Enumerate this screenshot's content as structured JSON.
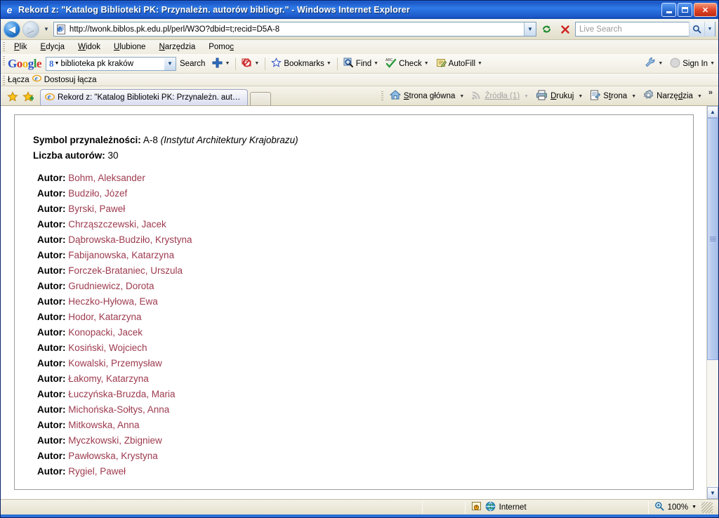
{
  "window": {
    "title": "Rekord z: \"Katalog Biblioteki PK: Przynależn. autorów bibliogr.\" - Windows Internet Explorer",
    "app_icon": "ie-logo-icon",
    "minimize_label": "_",
    "maximize_label": "□",
    "close_label": "✕"
  },
  "nav": {
    "back_label": "◀",
    "forward_label": "▶",
    "history_caret": "▼",
    "address": {
      "url": "http://twonk.biblos.pk.edu.pl/perl/W3O?dbid=t;recid=D5A-8",
      "page_icon": "page-icon",
      "dropdown_label": "▼"
    },
    "refresh_label": "⟳",
    "stop_label": "✕",
    "search": {
      "placeholder": "Live Search",
      "value": "",
      "go_label": "⌕",
      "dropdown_label": "▼"
    }
  },
  "menu": {
    "items": [
      {
        "pre": "P",
        "accel": "l",
        "post": "ik"
      },
      {
        "pre": "",
        "accel": "E",
        "post": "dycja"
      },
      {
        "pre": "",
        "accel": "W",
        "post": "idok"
      },
      {
        "pre": "",
        "accel": "U",
        "post": "lubione"
      },
      {
        "pre": "",
        "accel": "N",
        "post": "arzędzia"
      },
      {
        "pre": "Pomo",
        "accel": "c",
        "post": ""
      }
    ]
  },
  "google_toolbar": {
    "logo": [
      {
        "ch": "G",
        "cls": "b"
      },
      {
        "ch": "o",
        "cls": "r"
      },
      {
        "ch": "o",
        "cls": "y"
      },
      {
        "ch": "g",
        "cls": "b"
      },
      {
        "ch": "l",
        "cls": "g"
      },
      {
        "ch": "e",
        "cls": "r"
      }
    ],
    "search_value": "biblioteka pk kraków",
    "search_g": "8",
    "items": [
      {
        "label": "Search",
        "icon": "search-icon",
        "caret": false
      },
      {
        "label": "",
        "icon": "plus-icon",
        "caret": true
      },
      {
        "label": "",
        "icon": "blocker-icon",
        "caret": true
      },
      {
        "label": "Bookmarks",
        "icon": "star-icon",
        "caret": true
      },
      {
        "label": "Find",
        "icon": "find-icon",
        "caret": true
      },
      {
        "label": "Check",
        "icon": "spellcheck-icon",
        "caret": true
      },
      {
        "label": "AutoFill",
        "icon": "autofill-icon",
        "caret": true
      }
    ],
    "settings_icon": "wrench-icon",
    "signin_label": "Sign In",
    "signin_caret": "▼"
  },
  "links_bar": {
    "label": "Łącza",
    "item_label": "Dostosuj łącza",
    "item_icon": "ie-small-icon"
  },
  "tabbar": {
    "favorites_icon": "star-yellow-icon",
    "add_favorites_icon": "star-add-icon",
    "tab_title": "Rekord z: \"Katalog Biblioteki PK: Przynależn. autorów ...",
    "tab_icon": "ie-small-icon",
    "new_tab_label": ""
  },
  "command_bar": {
    "items": [
      {
        "label": "Strona główna",
        "accel": "S",
        "icon": "home-icon",
        "caret": true,
        "disabled": false
      },
      {
        "label": "Źródła (1)",
        "accel": "",
        "icon": "feeds-icon",
        "caret": true,
        "disabled": true
      },
      {
        "label": "Drukuj",
        "accel": "D",
        "icon": "print-icon",
        "caret": true,
        "disabled": false
      },
      {
        "label": "Strona",
        "accel": "t",
        "icon": "page-tools-icon",
        "caret": true,
        "disabled": false
      },
      {
        "label": "Narzędzia",
        "accel": "z",
        "icon": "gear-icon",
        "caret": true,
        "disabled": false
      }
    ],
    "overflow_label": "»"
  },
  "content": {
    "symbol_label": "Symbol przynależności:",
    "symbol_value": "A-8",
    "symbol_note": "(Instytut Architektury Krajobrazu)",
    "count_label": "Liczba autorów:",
    "count_value": "30",
    "author_label": "Autor:",
    "authors": [
      "Bohm, Aleksander",
      "Budziło, Józef",
      "Byrski, Paweł",
      "Chrząszczewski, Jacek",
      "Dąbrowska-Budziło, Krystyna",
      "Fabijanowska, Katarzyna",
      "Forczek-Brataniec, Urszula",
      "Grudniewicz, Dorota",
      "Heczko-Hyłowa, Ewa",
      "Hodor, Katarzyna",
      "Konopacki, Jacek",
      "Kosiński, Wojciech",
      "Kowalski, Przemysław",
      "Łakomy, Katarzyna",
      "Łuczyńska-Bruzda, Maria",
      "Michońska-Sołtys, Anna",
      "Mitkowska, Anna",
      "Myczkowski, Zbigniew",
      "Pawłowska, Krystyna",
      "Rygiel, Paweł"
    ]
  },
  "scrollbar": {
    "up_label": "▲",
    "down_label": "▼"
  },
  "statusbar": {
    "message": "",
    "zone_label": "Internet",
    "zone_icon": "globe-icon",
    "protect_icon": "protected-mode-icon",
    "zoom_label": "100%",
    "zoom_icon": "zoom-icon",
    "zoom_caret": "▼"
  },
  "colors": {
    "title_blue": "#1b56c4",
    "author_red": "#9d3a4e",
    "chrome_beige": "#ece9d8"
  }
}
